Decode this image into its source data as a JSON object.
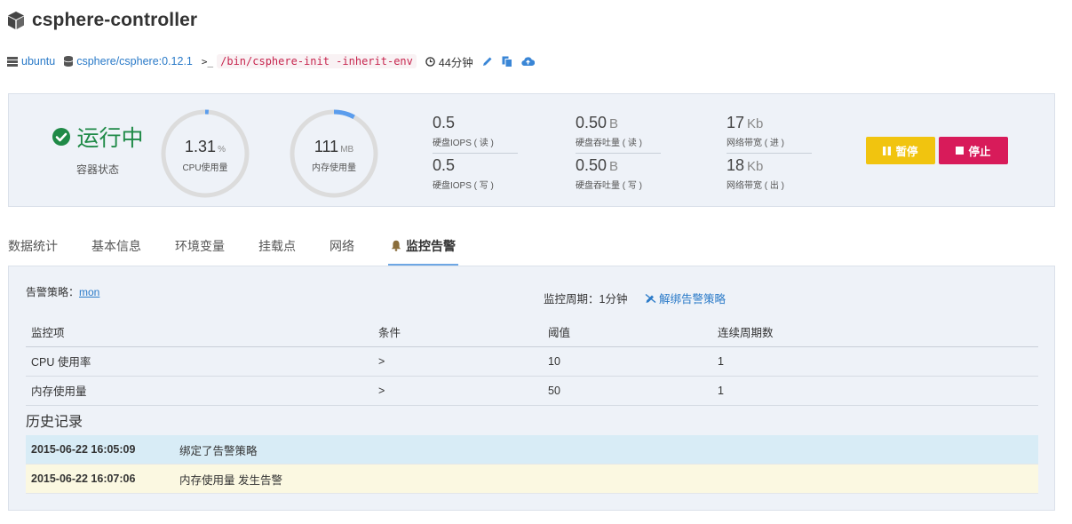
{
  "header": {
    "title": "csphere-controller"
  },
  "meta": {
    "host": "ubuntu",
    "image": "csphere/csphere:0.12.1",
    "prompt": ">_",
    "command": "/bin/csphere-init -inherit-env",
    "uptime": "44分钟"
  },
  "status": {
    "state": "运行中",
    "state_label": "容器状态",
    "cpu": {
      "value": "1.31",
      "unit": "%",
      "label": "CPU使用量",
      "fraction": 0.0131
    },
    "mem": {
      "value": "111",
      "unit": "MB",
      "label": "内存使用量",
      "fraction": 0.08
    },
    "stats": {
      "iops_read": {
        "value": "0.5",
        "unit": "",
        "label": "硬盘IOPS ( 读 )"
      },
      "iops_write": {
        "value": "0.5",
        "unit": "",
        "label": "硬盘IOPS ( 写 )"
      },
      "tp_read": {
        "value": "0.50",
        "unit": "B",
        "label": "硬盘吞吐量 ( 读 )"
      },
      "tp_write": {
        "value": "0.50",
        "unit": "B",
        "label": "硬盘吞吐量 ( 写 )"
      },
      "net_in": {
        "value": "17",
        "unit": "Kb",
        "label": "网络带宽 ( 进 )"
      },
      "net_out": {
        "value": "18",
        "unit": "Kb",
        "label": "网络带宽 ( 出 )"
      }
    },
    "pause_label": "暂停",
    "stop_label": "停止"
  },
  "tabs": [
    "数据统计",
    "基本信息",
    "环境变量",
    "挂载点",
    "网络",
    "监控告警"
  ],
  "alert": {
    "policy_label": "告警策略：",
    "policy_name": "mon",
    "period": "监控周期：1分钟",
    "unbind": "解绑告警策略",
    "columns": [
      "监控项",
      "条件",
      "阈值",
      "连续周期数"
    ],
    "rules": [
      [
        "CPU 使用率",
        ">",
        "10",
        "1"
      ],
      [
        "内存使用量",
        ">",
        "50",
        "1"
      ]
    ],
    "history_title": "历史记录",
    "history": [
      {
        "time": "2015-06-22 16:05:09",
        "desc": "绑定了告警策略"
      },
      {
        "time": "2015-06-22 16:07:06",
        "desc": "内存使用量 发生告警"
      }
    ]
  },
  "colors": {
    "accent": "#2a7ac8",
    "running": "#1f8a47",
    "pause": "#f1c40f",
    "stop": "#d81b5a",
    "gauge_track": "#dcdcdc",
    "gauge_fill": "#5b9ded"
  }
}
